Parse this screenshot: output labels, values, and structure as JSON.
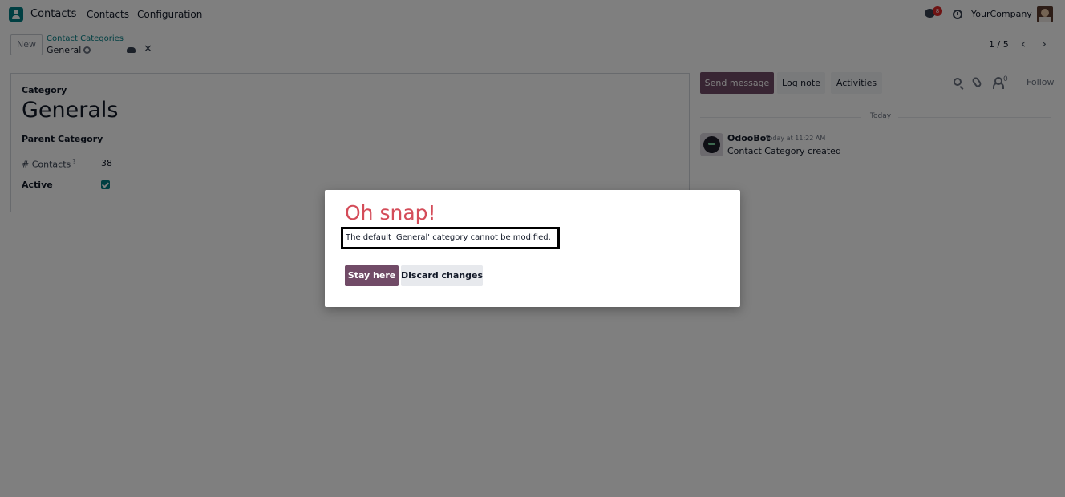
{
  "navbar": {
    "app_name": "Contacts",
    "menu": [
      "Contacts",
      "Configuration"
    ],
    "messages_badge": "8",
    "company": "YourCompany"
  },
  "control_panel": {
    "new_label": "New",
    "breadcrumb": "Contact Categories",
    "record_name": "General",
    "pager": "1 / 5"
  },
  "form": {
    "category_label": "Category",
    "name_value": "Generals",
    "parent_label": "Parent Category",
    "contacts_label": "# Contacts",
    "contacts_tooltip": "?",
    "contacts_value": "38",
    "active_label": "Active",
    "active_checked": true
  },
  "chatter": {
    "send_message": "Send message",
    "log_note": "Log note",
    "activities": "Activities",
    "followers_count": "0",
    "follow": "Follow",
    "date_separator": "Today",
    "messages": [
      {
        "author": "OdooBot",
        "time": "Today at 11:22 AM",
        "body": "Contact Category created"
      }
    ]
  },
  "dialog": {
    "title": "Oh snap!",
    "message": "The default 'General' category cannot be modified.",
    "stay_button": "Stay here",
    "discard_button": "Discard changes"
  },
  "colors": {
    "brand": "#714b67",
    "accent": "#017e84",
    "error_title": "#d44c59",
    "badge": "#dc2626"
  },
  "icons": [
    "app-logo-icon",
    "gear-icon",
    "save-icon",
    "discard-icon",
    "chevron-left-icon",
    "chevron-right-icon",
    "chat-icon",
    "clock-icon",
    "search-icon",
    "paperclip-icon",
    "follower-icon"
  ]
}
